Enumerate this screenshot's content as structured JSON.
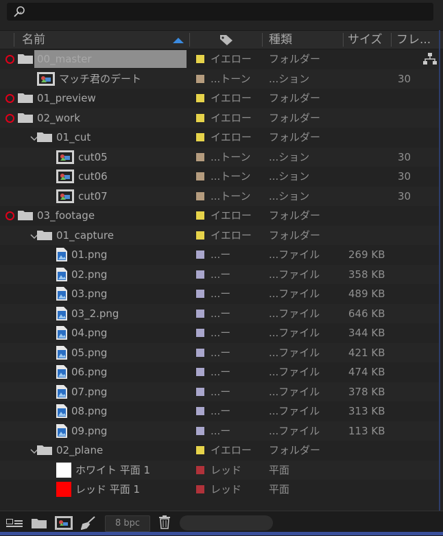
{
  "search": {
    "placeholder": ""
  },
  "header": {
    "name": "名前",
    "type": "種類",
    "size": "サイズ",
    "frame": "フレ..."
  },
  "footer": {
    "bpc": "8 bpc"
  },
  "colors": {
    "yellow": "#e6d34a",
    "tan": "#b59c7e",
    "lavender": "#a9a6cc",
    "red": "#b0323a",
    "selection": "#8e8e8e",
    "marker": "#e0001a"
  },
  "rows": [
    {
      "name": "00_master",
      "icon": "folder-icon",
      "indent": 0,
      "marked": true,
      "selected": true,
      "label": "イエロー",
      "color": "yellow",
      "type": "フォルダー",
      "size": "",
      "frame": ""
    },
    {
      "name": "マッチ君のデート",
      "icon": "composition-icon",
      "indent": 1,
      "label": "...トーン",
      "color": "tan",
      "type": "...ション",
      "size": "",
      "frame": "30"
    },
    {
      "name": "01_preview",
      "icon": "folder-icon",
      "indent": 0,
      "marked": true,
      "label": "イエロー",
      "color": "yellow",
      "type": "フォルダー",
      "size": "",
      "frame": ""
    },
    {
      "name": "02_work",
      "icon": "folder-icon",
      "indent": 0,
      "marked": true,
      "label": "イエロー",
      "color": "yellow",
      "type": "フォルダー",
      "size": "",
      "frame": ""
    },
    {
      "name": "01_cut",
      "icon": "folder-icon",
      "indent": 1,
      "expanded": true,
      "label": "イエロー",
      "color": "yellow",
      "type": "フォルダー",
      "size": "",
      "frame": ""
    },
    {
      "name": "cut05",
      "icon": "composition-icon",
      "indent": 2,
      "label": "...トーン",
      "color": "tan",
      "type": "...ション",
      "size": "",
      "frame": "30"
    },
    {
      "name": "cut06",
      "icon": "composition-icon",
      "indent": 2,
      "label": "...トーン",
      "color": "tan",
      "type": "...ション",
      "size": "",
      "frame": "30"
    },
    {
      "name": "cut07",
      "icon": "composition-icon",
      "indent": 2,
      "label": "...トーン",
      "color": "tan",
      "type": "...ション",
      "size": "",
      "frame": "30"
    },
    {
      "name": "03_footage",
      "icon": "folder-icon",
      "indent": 0,
      "marked": true,
      "label": "イエロー",
      "color": "yellow",
      "type": "フォルダー",
      "size": "",
      "frame": ""
    },
    {
      "name": "01_capture",
      "icon": "folder-icon",
      "indent": 1,
      "expanded": true,
      "label": "イエロー",
      "color": "yellow",
      "type": "フォルダー",
      "size": "",
      "frame": ""
    },
    {
      "name": "01.png",
      "icon": "image-file-icon",
      "indent": 2,
      "label": "...ー",
      "color": "lavender",
      "type": "...ファイル",
      "size": "269 KB",
      "frame": ""
    },
    {
      "name": "02.png",
      "icon": "image-file-icon",
      "indent": 2,
      "label": "...ー",
      "color": "lavender",
      "type": "...ファイル",
      "size": "358 KB",
      "frame": ""
    },
    {
      "name": "03.png",
      "icon": "image-file-icon",
      "indent": 2,
      "label": "...ー",
      "color": "lavender",
      "type": "...ファイル",
      "size": "489 KB",
      "frame": ""
    },
    {
      "name": "03_2.png",
      "icon": "image-file-icon",
      "indent": 2,
      "label": "...ー",
      "color": "lavender",
      "type": "...ファイル",
      "size": "646 KB",
      "frame": ""
    },
    {
      "name": "04.png",
      "icon": "image-file-icon",
      "indent": 2,
      "label": "...ー",
      "color": "lavender",
      "type": "...ファイル",
      "size": "344 KB",
      "frame": ""
    },
    {
      "name": "05.png",
      "icon": "image-file-icon",
      "indent": 2,
      "label": "...ー",
      "color": "lavender",
      "type": "...ファイル",
      "size": "421 KB",
      "frame": ""
    },
    {
      "name": "06.png",
      "icon": "image-file-icon",
      "indent": 2,
      "label": "...ー",
      "color": "lavender",
      "type": "...ファイル",
      "size": "474 KB",
      "frame": ""
    },
    {
      "name": "07.png",
      "icon": "image-file-icon",
      "indent": 2,
      "label": "...ー",
      "color": "lavender",
      "type": "...ファイル",
      "size": "378 KB",
      "frame": ""
    },
    {
      "name": "08.png",
      "icon": "image-file-icon",
      "indent": 2,
      "label": "...ー",
      "color": "lavender",
      "type": "...ファイル",
      "size": "313 KB",
      "frame": ""
    },
    {
      "name": "09.png",
      "icon": "image-file-icon",
      "indent": 2,
      "label": "...ー",
      "color": "lavender",
      "type": "...ファイル",
      "size": "113 KB",
      "frame": ""
    },
    {
      "name": "02_plane",
      "icon": "folder-icon",
      "indent": 1,
      "expanded": true,
      "label": "イエロー",
      "color": "yellow",
      "type": "フォルダー",
      "size": "",
      "frame": ""
    },
    {
      "name": "ホワイト 平面 1",
      "icon": "white-solid-icon",
      "indent": 2,
      "label": "レッド",
      "color": "red",
      "type": "平面",
      "size": "",
      "frame": ""
    },
    {
      "name": "レッド 平面 1",
      "icon": "red-solid-icon",
      "indent": 2,
      "label": "レッド",
      "color": "red",
      "type": "平面",
      "size": "",
      "frame": ""
    }
  ]
}
